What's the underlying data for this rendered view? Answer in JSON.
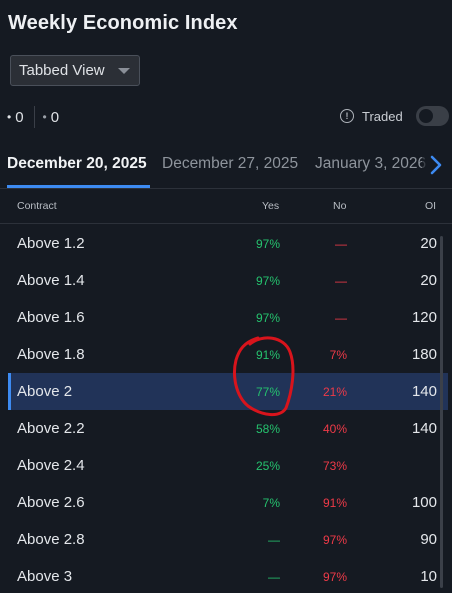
{
  "title": "Weekly Economic Index",
  "view_select": {
    "value": "Tabbed View"
  },
  "counters": [
    {
      "bullet": "•",
      "value": "0"
    },
    {
      "bullet": "•",
      "value": "0"
    }
  ],
  "traded": {
    "label": "Traded",
    "enabled": false
  },
  "tabs": [
    {
      "label": "December 20, 2025",
      "active": true
    },
    {
      "label": "December 27, 2025",
      "active": false
    },
    {
      "label": "January 3, 2026",
      "active": false
    }
  ],
  "table": {
    "headers": {
      "contract": "Contract",
      "yes": "Yes",
      "no": "No",
      "oi": "OI"
    },
    "rows": [
      {
        "contract": "Above 1.2",
        "yes": "97%",
        "no": "—",
        "oi": "20"
      },
      {
        "contract": "Above 1.4",
        "yes": "97%",
        "no": "—",
        "oi": "20"
      },
      {
        "contract": "Above 1.6",
        "yes": "97%",
        "no": "—",
        "oi": "120"
      },
      {
        "contract": "Above 1.8",
        "yes": "91%",
        "no": "7%",
        "oi": "180"
      },
      {
        "contract": "Above 2",
        "yes": "77%",
        "no": "21%",
        "oi": "140"
      },
      {
        "contract": "Above 2.2",
        "yes": "58%",
        "no": "40%",
        "oi": "140"
      },
      {
        "contract": "Above 2.4",
        "yes": "25%",
        "no": "73%",
        "oi": ""
      },
      {
        "contract": "Above 2.6",
        "yes": "7%",
        "no": "91%",
        "oi": "100"
      },
      {
        "contract": "Above 2.8",
        "yes": "—",
        "no": "97%",
        "oi": "90"
      },
      {
        "contract": "Above 3",
        "yes": "—",
        "no": "97%",
        "oi": "10"
      }
    ],
    "selected_row": "Above 2"
  },
  "colors": {
    "background": "#151a22",
    "yes": "#25c26e",
    "no": "#ee3a48",
    "accent": "#3d8bf2",
    "selected_row": "#213358",
    "annotation": "#d8141c"
  },
  "icons": {
    "dropdown": "chevron-down-icon",
    "info": "info-icon",
    "next_tab": "chevron-right-icon"
  }
}
